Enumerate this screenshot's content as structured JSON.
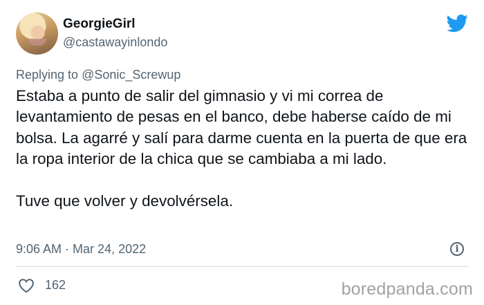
{
  "author": {
    "display_name": "GeorgieGirl",
    "handle": "@castawayinlondo"
  },
  "reply": {
    "prefix": "Replying to ",
    "mention": "@Sonic_Screwup"
  },
  "tweet": {
    "paragraph_1": "Estaba a punto de salir del gimnasio y vi mi correa de levantamiento de pesas en el banco, debe haberse caído de mi bolsa. La agarré y salí para darme cuenta en la puerta de que era la ropa interior de la chica que se cambiaba a mi lado.",
    "paragraph_2": "Tuve que volver y devolvérsela."
  },
  "meta": {
    "time": "9:06 AM",
    "separator": " · ",
    "date": "Mar 24, 2022",
    "info_glyph": "i"
  },
  "actions": {
    "like_count": "162"
  },
  "watermark": "boredpanda.com",
  "icons": {
    "brand": "twitter-bird-icon",
    "like": "heart-outline-icon",
    "info": "info-circle-icon"
  },
  "colors": {
    "text": "#0f1419",
    "secondary": "#536471",
    "twitter_blue": "#1d9bf0",
    "divider": "#cfd9de",
    "watermark": "#a2a2a2"
  }
}
